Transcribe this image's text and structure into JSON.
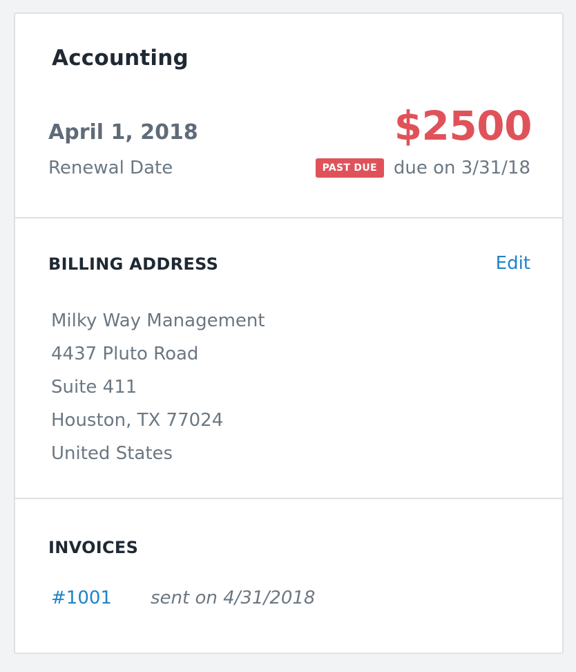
{
  "account": {
    "title": "Accounting",
    "renewal_date": "April 1, 2018",
    "renewal_label": "Renewal Date",
    "amount": "$2500",
    "status_badge": "PAST DUE",
    "due_text": "due on 3/31/18"
  },
  "billing": {
    "heading": "BILLING ADDRESS",
    "edit_label": "Edit",
    "address_lines": [
      "Milky Way Management",
      "4437 Pluto Road",
      "Suite 411",
      "Houston, TX 77024",
      "United States"
    ]
  },
  "invoices": {
    "heading": "INVOICES",
    "items": [
      {
        "number": "#1001",
        "sent": "sent on 4/31/2018"
      }
    ]
  },
  "colors": {
    "accent_red": "#e0525a",
    "link_blue": "#1f83c8",
    "text_dark": "#1f2933",
    "text_muted": "#6b7782",
    "border": "#dde0e4"
  }
}
